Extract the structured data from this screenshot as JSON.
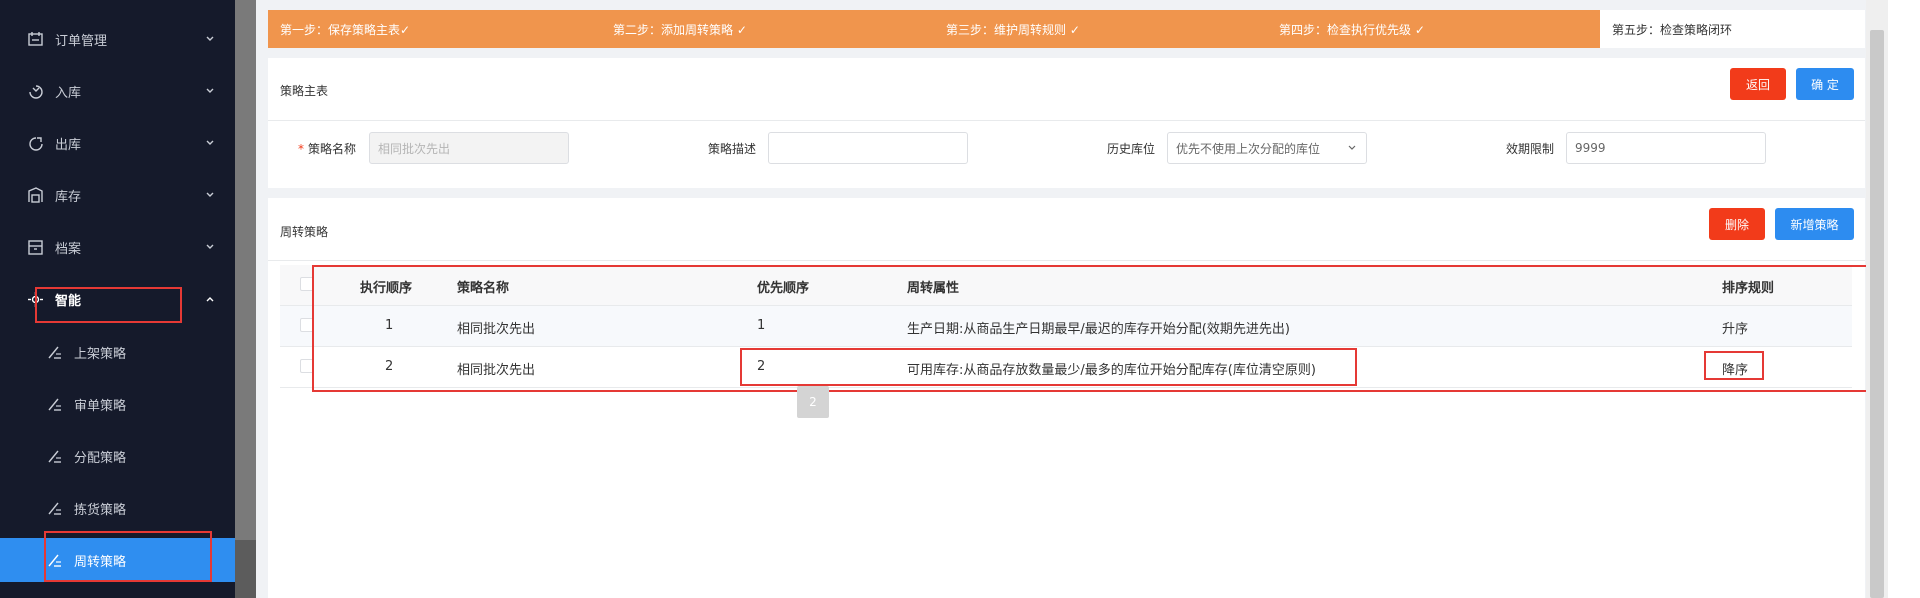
{
  "sidebar": {
    "items": [
      {
        "label": "订单管理",
        "icon": "order-icon"
      },
      {
        "label": "入库",
        "icon": "inbound-icon"
      },
      {
        "label": "出库",
        "icon": "outbound-icon"
      },
      {
        "label": "库存",
        "icon": "inventory-icon"
      },
      {
        "label": "档案",
        "icon": "archive-icon"
      },
      {
        "label": "智能",
        "icon": "smart-icon"
      }
    ],
    "subitems": [
      {
        "label": "上架策略",
        "icon": "strategy-icon"
      },
      {
        "label": "审单策略",
        "icon": "strategy-icon"
      },
      {
        "label": "分配策略",
        "icon": "strategy-icon"
      },
      {
        "label": "拣货策略",
        "icon": "strategy-icon"
      },
      {
        "label": "周转策略",
        "icon": "strategy-icon"
      }
    ]
  },
  "steps": [
    "第一步：保存策略主表✓",
    "第二步：添加周转策略 ✓",
    "第三步：维护周转规则 ✓",
    "第四步：检查执行优先级 ✓",
    "第五步：检查策略闭环"
  ],
  "master": {
    "title": "策略主表",
    "back_label": "返回",
    "confirm_label": "确 定",
    "fields": {
      "name_label": "策略名称",
      "name_placeholder": "相同批次先出",
      "desc_label": "策略描述",
      "desc_value": "",
      "history_label": "历史库位",
      "history_value": "优先不使用上次分配的库位",
      "expiry_label": "效期限制",
      "expiry_value": "9999"
    }
  },
  "turnover": {
    "title": "周转策略",
    "delete_label": "删除",
    "add_label": "新增策略",
    "columns": [
      "执行顺序",
      "策略名称",
      "优先顺序",
      "周转属性",
      "排序规则"
    ],
    "rows": [
      {
        "order": "1",
        "name": "相同批次先出",
        "priority": "1",
        "attribute": "生产日期:从商品生产日期最早/最迟的库存开始分配(效期先进先出)",
        "sort": "升序"
      },
      {
        "order": "2",
        "name": "相同批次先出",
        "priority": "2",
        "attribute": "可用库存:从商品存放数量最少/最多的库位开始分配库存(库位清空原则)",
        "sort": "降序"
      }
    ],
    "tooltip": "2"
  },
  "colors": {
    "sidebar_bg": "#151a2b",
    "active": "#2f8ef0",
    "step_done": "#f0954d",
    "danger": "#f23b1a",
    "primary": "#2d8cf0",
    "highlight": "#e53935"
  }
}
